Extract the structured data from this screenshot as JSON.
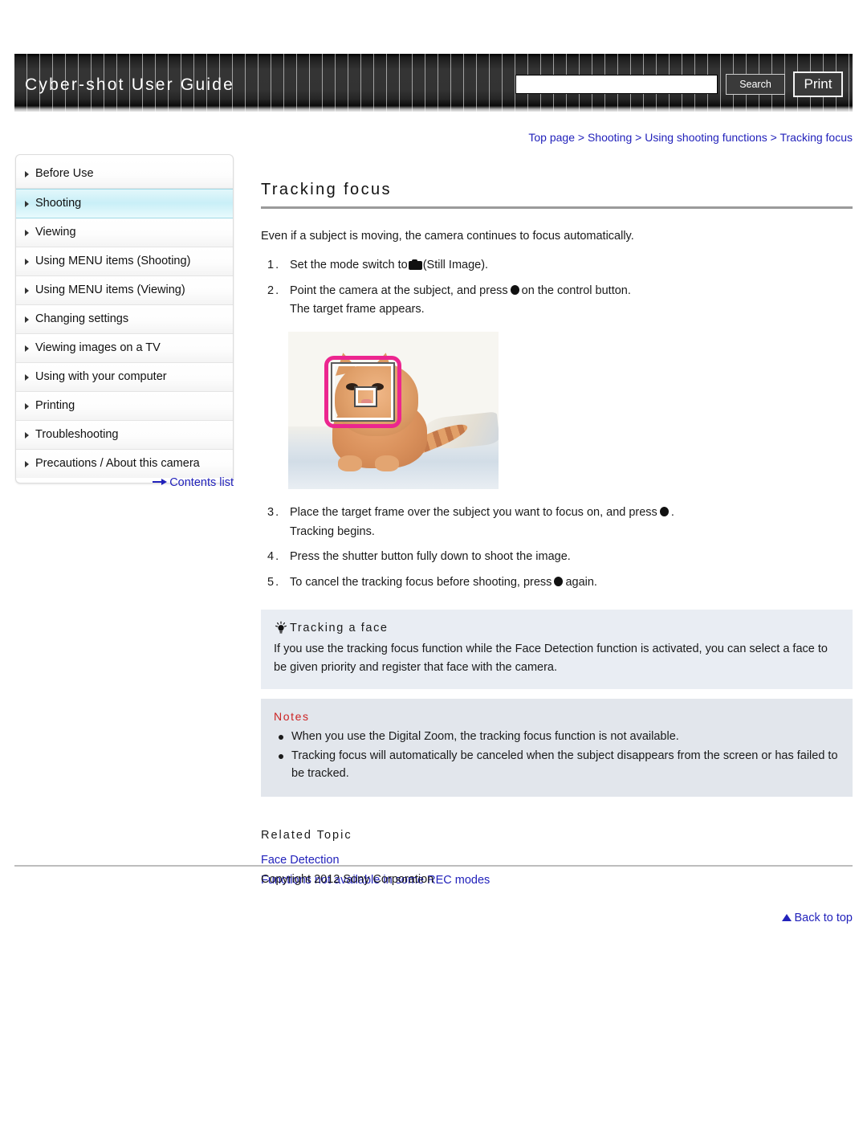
{
  "header": {
    "site_title": "Cyber-shot User Guide",
    "search_placeholder": "",
    "search_value": "",
    "search_button": "Search",
    "print_button": "Print"
  },
  "sidebar": {
    "items": [
      {
        "label": "Before Use",
        "active": false
      },
      {
        "label": "Shooting",
        "active": true
      },
      {
        "label": "Viewing",
        "active": false
      },
      {
        "label": "Using MENU items (Shooting)",
        "active": false
      },
      {
        "label": "Using MENU items (Viewing)",
        "active": false
      },
      {
        "label": "Changing settings",
        "active": false
      },
      {
        "label": "Viewing images on a TV",
        "active": false
      },
      {
        "label": "Using with your computer",
        "active": false
      },
      {
        "label": "Printing",
        "active": false
      },
      {
        "label": "Troubleshooting",
        "active": false
      },
      {
        "label": "Precautions / About this camera",
        "active": false
      }
    ],
    "contents_link": "Contents list"
  },
  "breadcrumb": {
    "items": [
      "Top page",
      "Shooting",
      "Using shooting functions",
      "Tracking focus"
    ],
    "separator": ">"
  },
  "main": {
    "title": "Tracking focus",
    "intro": "Even if a subject is moving, the camera continues to focus automatically.",
    "steps": [
      {
        "num": "1.",
        "text_before": "Set the mode switch to",
        "icon": "camera-icon",
        "text_after": "(Still Image).",
        "sub": ""
      },
      {
        "num": "2.",
        "text_before": "Point the camera at the subject, and press",
        "icon": "control-button-center-icon",
        "text_after": "on the control button.",
        "sub": "The target frame appears."
      },
      {
        "num": "3.",
        "text_before": "Place the target frame over the subject you want to focus on, and press",
        "icon": "control-button-center-icon",
        "text_after": ".",
        "sub": "Tracking begins."
      },
      {
        "num": "4.",
        "text_before": "Press the shutter button fully down to shoot the image.",
        "icon": "",
        "text_after": "",
        "sub": ""
      },
      {
        "num": "5.",
        "text_before": "To cancel the tracking focus before shooting, press",
        "icon": "control-button-center-icon",
        "text_after": "again.",
        "sub": ""
      }
    ],
    "illustration_alt": "Camera screen showing a cat with the pink tracking target frame over its face"
  },
  "tip": {
    "icon": "lightbulb-icon",
    "heading": "Tracking a face",
    "body": "If you use the tracking focus function while the Face Detection function is activated, you can select a face to be given priority and register that face with the camera."
  },
  "notes": {
    "heading": "Notes",
    "items": [
      "When you use the Digital Zoom, the tracking focus function is not available.",
      "Tracking focus will automatically be canceled when the subject disappears from the screen or has failed to be tracked."
    ]
  },
  "related": {
    "heading": "Related Topic",
    "links": [
      "Face Detection",
      "Functions not available in some REC modes"
    ]
  },
  "footer": {
    "back_to_top": "Back to top",
    "copyright": "Copyright 2012 Sony Corporation"
  },
  "colors": {
    "link": "#2222bb",
    "accent_highlight": "#c9eff7",
    "notes_heading": "#cc2222",
    "target_frame": "#ec268f"
  }
}
